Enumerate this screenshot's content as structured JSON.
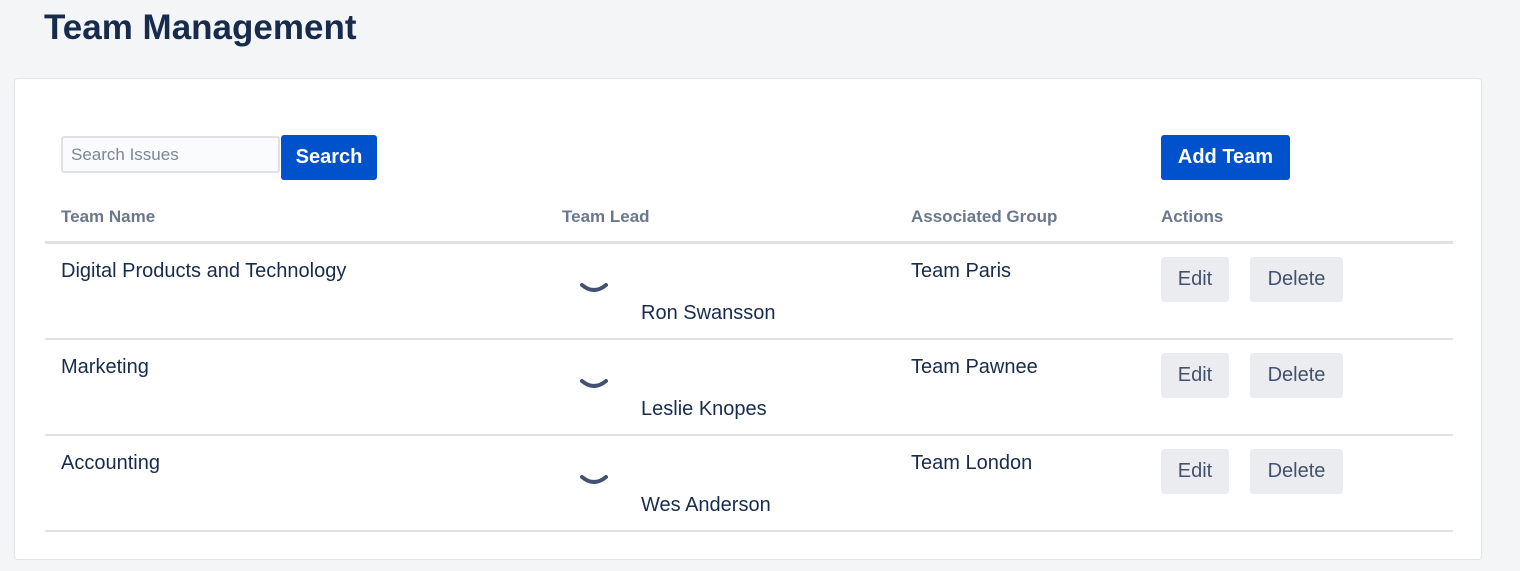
{
  "page": {
    "title": "Team Management"
  },
  "toolbar": {
    "search_placeholder": "Search Issues",
    "search_value": "",
    "search_label": "Search",
    "add_label": "Add Team"
  },
  "table": {
    "headers": [
      "Team Name",
      "Team Lead",
      "Associated Group",
      "Actions"
    ],
    "rows": [
      {
        "name": "Digital Products and Technology",
        "lead": "Ron Swansson",
        "group": "Team Paris",
        "edit": "Edit",
        "delete": "Delete"
      },
      {
        "name": "Marketing",
        "lead": "Leslie Knopes",
        "group": "Team Pawnee",
        "edit": "Edit",
        "delete": "Delete"
      },
      {
        "name": "Accounting",
        "lead": "Wes Anderson",
        "group": "Team London",
        "edit": "Edit",
        "delete": "Delete"
      }
    ]
  },
  "icons": {
    "lead_avatar": "loading-spinner-icon"
  },
  "colors": {
    "primary": "#0052cc",
    "background": "#f4f5f7",
    "text": "#172b4d",
    "header_text": "#6b778c",
    "subtle_button": "#ebecf0"
  }
}
